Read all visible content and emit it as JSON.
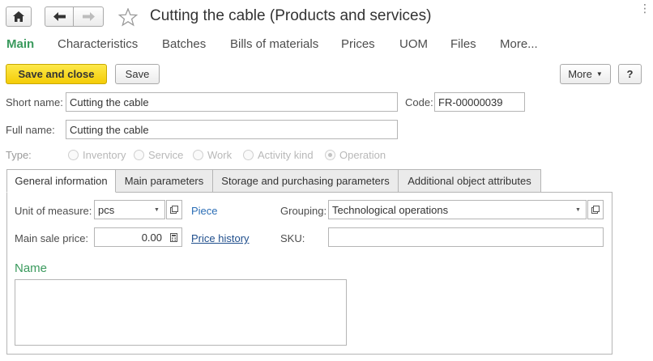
{
  "window": {
    "title": "Cutting the cable (Products and services)"
  },
  "sections": [
    {
      "label": "Main",
      "active": true
    },
    {
      "label": "Characteristics"
    },
    {
      "label": "Batches"
    },
    {
      "label": "Bills of materials"
    },
    {
      "label": "Prices"
    },
    {
      "label": "UOM"
    },
    {
      "label": "Files"
    },
    {
      "label": "More..."
    }
  ],
  "toolbar": {
    "save_close_label": "Save and close",
    "save_label": "Save",
    "more_label": "More",
    "help_label": "?"
  },
  "form": {
    "short_name_label": "Short name:",
    "short_name_value": "Cutting the cable",
    "code_label": "Code:",
    "code_value": "FR-00000039",
    "full_name_label": "Full name:",
    "full_name_value": "Cutting the cable",
    "type_label": "Type:",
    "type_options": [
      "Inventory",
      "Service",
      "Work",
      "Activity kind",
      "Operation"
    ],
    "type_selected": "Operation"
  },
  "tabs": [
    {
      "label": "General information",
      "active": true
    },
    {
      "label": "Main parameters"
    },
    {
      "label": "Storage and purchasing parameters"
    },
    {
      "label": "Additional object attributes"
    }
  ],
  "general": {
    "uom_label": "Unit of measure:",
    "uom_value": "pcs",
    "uom_link": "Piece",
    "grouping_label": "Grouping:",
    "grouping_value": "Technological operations",
    "price_label": "Main sale price:",
    "price_value": "0.00",
    "price_history_link": "Price history",
    "sku_label": "SKU:",
    "sku_value": "",
    "name_header": "Name",
    "name_value": ""
  },
  "colors": {
    "accent_green": "#3a9a5d",
    "primary_button": "#f4cc07",
    "link_blue": "#2a6db5"
  }
}
